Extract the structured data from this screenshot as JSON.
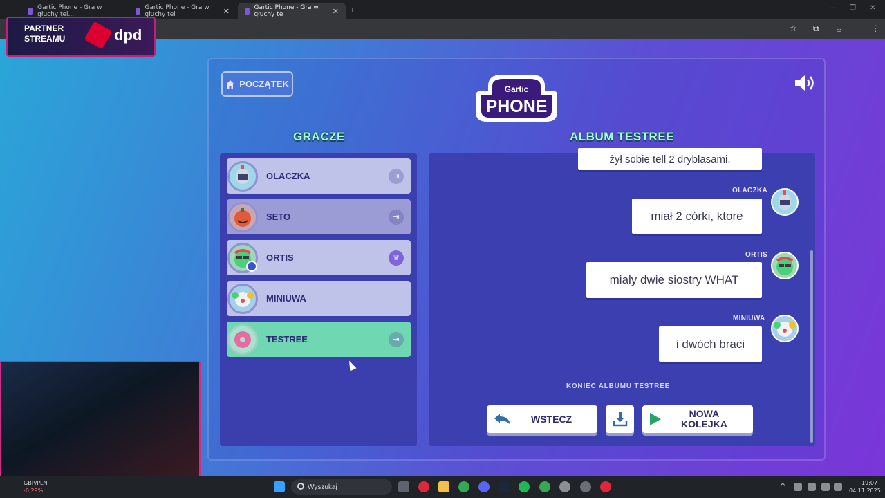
{
  "browser": {
    "tabs": [
      {
        "label": "Gartic Phone - Gra w głuchy tel..."
      },
      {
        "label": "Gartic Phone - Gra w głuchy tel"
      },
      {
        "label": "Gartic Phone - Gra w głuchy te"
      }
    ],
    "new_tab": "+",
    "window_controls": [
      "—",
      "❐",
      "✕"
    ]
  },
  "game": {
    "home_label": "POCZĄTEK",
    "logo_top": "Gartic",
    "logo_main": "PHONE",
    "players_heading": "GRACZE",
    "album_heading": "ALBUM TESTREE",
    "players": [
      {
        "name": "OLACZKA",
        "action": "exit-icon"
      },
      {
        "name": "SETO",
        "action": "exit-icon"
      },
      {
        "name": "ORTIS",
        "action": "crown-icon"
      },
      {
        "name": "MINIUWA",
        "action": ""
      },
      {
        "name": "TESTREE",
        "action": "exit-icon"
      }
    ],
    "album": {
      "entries": [
        {
          "author": "",
          "text": "żył sobie  tell 2 dryblasami."
        },
        {
          "author": "OLACZKA",
          "text": "miał 2 córki, ktore"
        },
        {
          "author": "ORTIS",
          "text": "mialy dwie siostry WHAT"
        },
        {
          "author": "MINIUWA",
          "text": "i dwóch braci"
        }
      ],
      "end_label": "KONIEC ALBUMU TESTREE",
      "back_label": "WSTECZ",
      "new_round_line1": "NOWA",
      "new_round_line2": "KOLEJKA"
    }
  },
  "overlay": {
    "partner_line1": "PARTNER",
    "partner_line2": "STREAMU",
    "sponsor": "dpd"
  },
  "taskbar": {
    "ticker_pair": "GBP/PLN",
    "ticker_change": "-0,29%",
    "search_placeholder": "Wyszukaj",
    "time": "19:07",
    "date": "04.11.2025"
  },
  "colors": {
    "accent_green": "#6fd8b2",
    "heading_green": "#a8ffcf",
    "panel_blue": "#3c3fb0"
  }
}
